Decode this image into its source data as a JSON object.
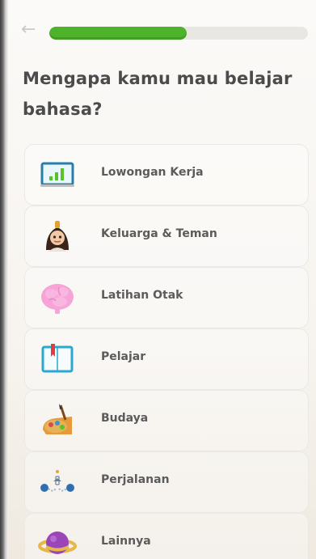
{
  "header": {
    "back_icon": "arrow-left-icon",
    "progress_fraction": 0.53
  },
  "question": {
    "line1": "Mengapa kamu mau belajar",
    "line2": "bahasa?"
  },
  "options": [
    {
      "label": "Lowongan Kerja",
      "icon": "chart-icon"
    },
    {
      "label": "Keluarga & Teman",
      "icon": "family-icon"
    },
    {
      "label": "Latihan Otak",
      "icon": "brain-icon"
    },
    {
      "label": "Pelajar",
      "icon": "book-icon"
    },
    {
      "label": "Budaya",
      "icon": "culture-icon"
    },
    {
      "label": "Perjalanan",
      "icon": "travel-icon"
    },
    {
      "label": "Lainnya",
      "icon": "planet-icon"
    }
  ],
  "colors": {
    "progress": "#4db32a",
    "track": "#e8e7e4",
    "text": "#4b4b4b"
  }
}
